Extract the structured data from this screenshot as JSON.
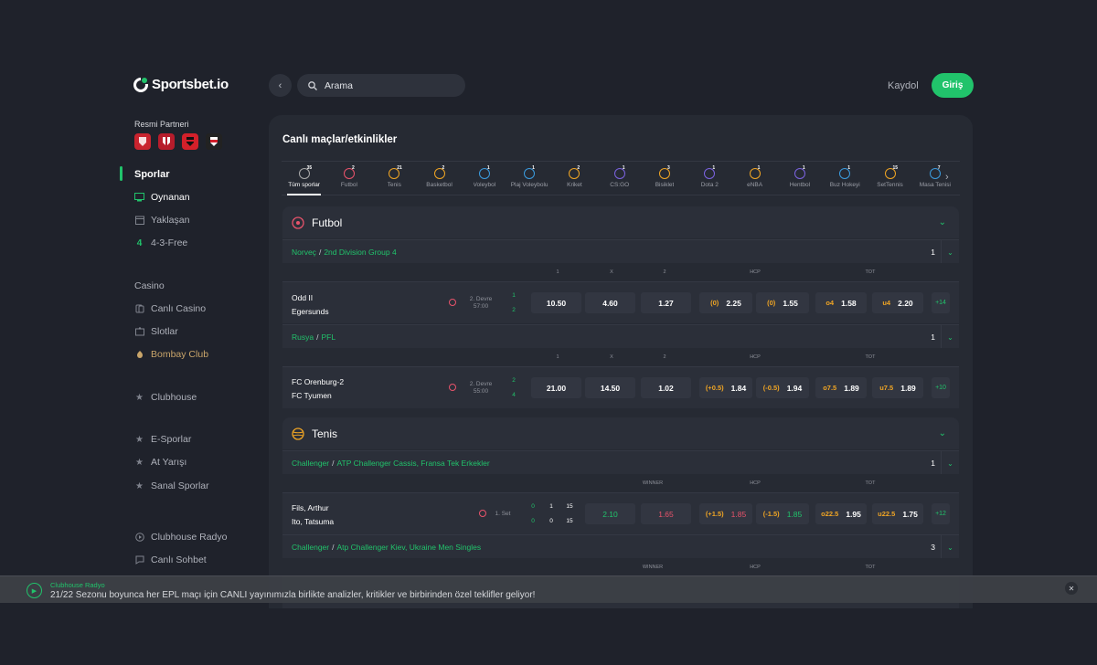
{
  "brand": {
    "name": "Sportsbet.io"
  },
  "partners": {
    "label": "Resmi Partneri",
    "crests": [
      "#c9232e",
      "#b71c2b",
      "#d4202a",
      "#222222"
    ]
  },
  "sidebar": {
    "sports_heading": "Sporlar",
    "items": [
      {
        "label": "Oynanan",
        "icon": "monitor-icon"
      },
      {
        "label": "Yaklaşan",
        "icon": "calendar-icon"
      },
      {
        "label": "4-3-Free",
        "icon": "number-four-icon"
      }
    ],
    "casino_heading": "Casino",
    "casino_items": [
      {
        "label": "Canlı Casino",
        "icon": "cards-icon"
      },
      {
        "label": "Slotlar",
        "icon": "slot-icon"
      },
      {
        "label": "Bombay Club",
        "icon": "bombay-icon"
      }
    ],
    "clubhouse": "Clubhouse",
    "extra_items": [
      {
        "label": "E-Sporlar",
        "icon": "star-icon"
      },
      {
        "label": "At Yarışı",
        "icon": "star-icon"
      },
      {
        "label": "Sanal Sporlar",
        "icon": "star-icon"
      }
    ],
    "bottom_items": [
      {
        "label": "Clubhouse Radyo",
        "icon": "radio-icon"
      },
      {
        "label": "Canlı Sohbet",
        "icon": "chat-icon"
      }
    ]
  },
  "header": {
    "search_placeholder": "Arama",
    "register": "Kaydol",
    "login": "Giriş"
  },
  "main": {
    "title": "Canlı maçlar/etkinlikler",
    "sports_tabs": [
      {
        "label": "Tüm sporlar",
        "count": "35",
        "active": true
      },
      {
        "label": "Futbol",
        "count": "2"
      },
      {
        "label": "Tenis",
        "count": "21"
      },
      {
        "label": "Basketbol",
        "count": "2"
      },
      {
        "label": "Voleybol",
        "count": "1"
      },
      {
        "label": "Plaj Voleybolu",
        "count": "1"
      },
      {
        "label": "Kriket",
        "count": "2"
      },
      {
        "label": "CS:GO",
        "count": "1"
      },
      {
        "label": "Bisiklet",
        "count": "3"
      },
      {
        "label": "Dota 2",
        "count": "1"
      },
      {
        "label": "eNBA",
        "count": "1"
      },
      {
        "label": "Hentbol",
        "count": "1"
      },
      {
        "label": "Buz Hokeyi",
        "count": "1"
      },
      {
        "label": "SetTennis",
        "count": "15"
      },
      {
        "label": "Masa Tenisi",
        "count": "7"
      }
    ],
    "football": {
      "title": "Futbol",
      "leagues": [
        {
          "country": "Norveç",
          "name": "2nd Division Group 4",
          "count": "1",
          "cols": [
            "1",
            "X",
            "2",
            "HCP",
            "TOT"
          ],
          "match": {
            "home": "Odd II",
            "away": "Egersunds",
            "period": "2. Devre",
            "time": "57:00",
            "score_home": "1",
            "score_away": "2",
            "odds": [
              "10.50",
              "4.60",
              "1.27"
            ],
            "hcp": [
              [
                "(0)",
                "2.25"
              ],
              [
                "(0)",
                "1.55"
              ]
            ],
            "tot": [
              [
                "o4",
                "1.58"
              ],
              [
                "u4",
                "2.20"
              ]
            ],
            "more": "+14"
          }
        },
        {
          "country": "Rusya",
          "name": "PFL",
          "count": "1",
          "cols": [
            "1",
            "X",
            "2",
            "HCP",
            "TOT"
          ],
          "match": {
            "home": "FC Orenburg-2",
            "away": "FC Tyumen",
            "period": "2. Devre",
            "time": "55:00",
            "score_home": "2",
            "score_away": "4",
            "odds": [
              "21.00",
              "14.50",
              "1.02"
            ],
            "hcp": [
              [
                "(+0.5)",
                "1.84"
              ],
              [
                "(-0.5)",
                "1.94"
              ]
            ],
            "tot": [
              [
                "o7.5",
                "1.89"
              ],
              [
                "u7.5",
                "1.89"
              ]
            ],
            "more": "+10"
          }
        }
      ]
    },
    "tennis": {
      "title": "Tenis",
      "leagues": [
        {
          "country": "Challenger",
          "name": "ATP Challenger Cassis, Fransa Tek Erkekler",
          "count": "1",
          "cols": [
            "WINNER",
            "HCP",
            "TOT"
          ],
          "match": {
            "home": "Fils, Arthur",
            "away": "Ito, Tatsuma",
            "period": "1. Set",
            "sets_home": [
              "0",
              "1",
              "15"
            ],
            "sets_away": [
              "0",
              "0",
              "15"
            ],
            "winner": [
              "2.10",
              "1.65"
            ],
            "hcp": [
              [
                "(+1.5)",
                "1.85"
              ],
              [
                "(-1.5)",
                "1.85"
              ]
            ],
            "tot": [
              [
                "o22.5",
                "1.95"
              ],
              [
                "u22.5",
                "1.75"
              ]
            ],
            "more": "+12"
          }
        },
        {
          "country": "Challenger",
          "name": "Atp Challenger Kiev, Ukraine Men Singles",
          "count": "3",
          "cols": [
            "WINNER",
            "HCP",
            "TOT"
          ]
        }
      ]
    }
  },
  "ticker": {
    "title": "Clubhouse Radyo",
    "text": "21/22 Sezonu boyunca her EPL maçı için CANLI yayınımızla birlikte analizler, kritikler ve birbirinden özel teklifler geliyor!"
  }
}
